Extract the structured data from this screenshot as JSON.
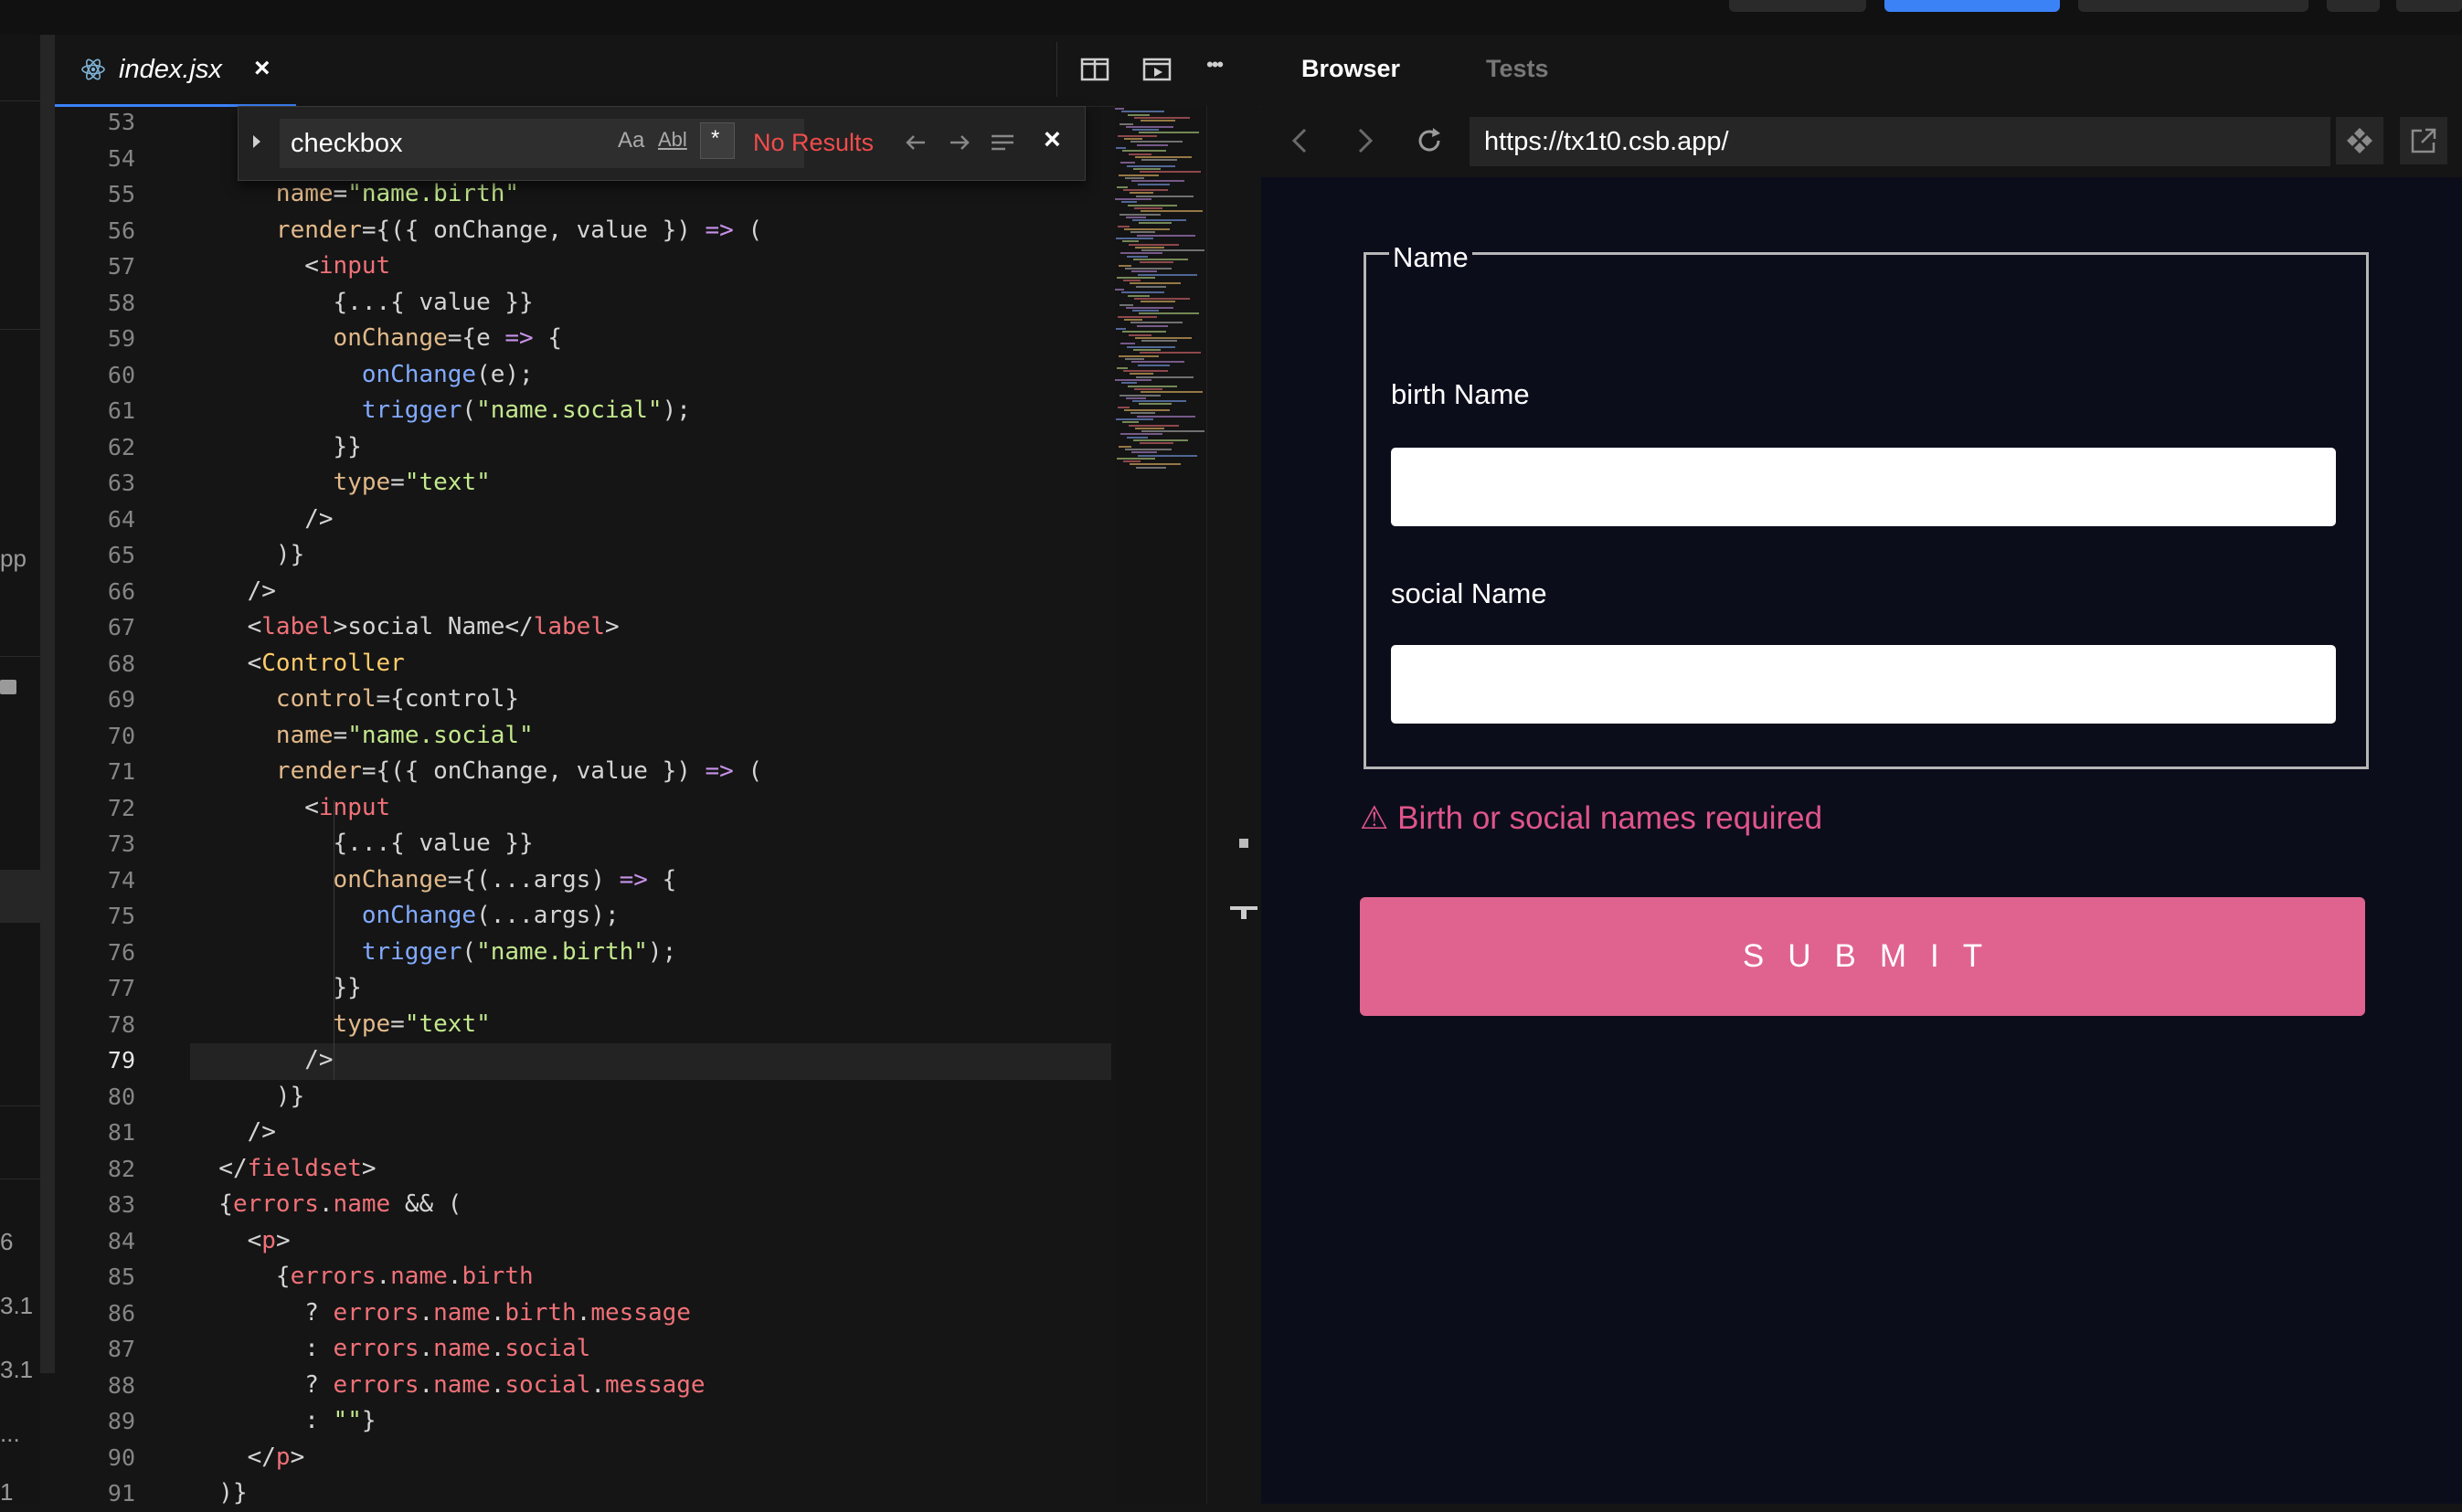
{
  "colors": {
    "accent": "#3b82f6",
    "error": "#e0558a",
    "submit": "#df638e",
    "browser_bg": "#0c0d1b"
  },
  "left_strip": {
    "fragments": [
      "pp",
      "6",
      "3.1",
      "3.1",
      "...",
      "1"
    ]
  },
  "editor": {
    "tab": {
      "title": "index.jsx",
      "close": "×",
      "icon": "react-icon"
    },
    "toolbar": {
      "more": "•••"
    },
    "find": {
      "query": "checkbox",
      "case_label": "Aa",
      "word_label": "Abl",
      "regex_label": "*",
      "status": "No Results",
      "close": "×"
    },
    "current_line": "79",
    "lines": [
      {
        "n": "53",
        "h": ""
      },
      {
        "n": "54",
        "h": ""
      },
      {
        "n": "55",
        "h": "      <span class=\"t-attr\">name</span>=<span class=\"t-str\">\"name.birth\"</span>"
      },
      {
        "n": "56",
        "h": "      <span class=\"t-attr\">render</span>={({ onChange, value }) <span class=\"t-kw\">=&gt;</span> ("
      },
      {
        "n": "57",
        "h": "        &lt;<span class=\"t-tag\">input</span>"
      },
      {
        "n": "58",
        "h": "          {...{ value }}"
      },
      {
        "n": "59",
        "h": "          <span class=\"t-attr\">onChange</span>={e <span class=\"t-kw\">=&gt;</span> {"
      },
      {
        "n": "60",
        "h": "            <span class=\"t-fn\">onChange</span>(e);"
      },
      {
        "n": "61",
        "h": "            <span class=\"t-fn\">trigger</span>(<span class=\"t-str\">\"name.social\"</span>);"
      },
      {
        "n": "62",
        "h": "          }}"
      },
      {
        "n": "63",
        "h": "          <span class=\"t-attr\">type</span>=<span class=\"t-str\">\"text\"</span>"
      },
      {
        "n": "64",
        "h": "        /&gt;"
      },
      {
        "n": "65",
        "h": "      )}"
      },
      {
        "n": "66",
        "h": "    /&gt;"
      },
      {
        "n": "67",
        "h": "    &lt;<span class=\"t-tag\">label</span>&gt;social Name&lt;/<span class=\"t-tag\">label</span>&gt;"
      },
      {
        "n": "68",
        "h": "    &lt;<span class=\"t-comp\">Controller</span>"
      },
      {
        "n": "69",
        "h": "      <span class=\"t-attr\">control</span>={control}"
      },
      {
        "n": "70",
        "h": "      <span class=\"t-attr\">name</span>=<span class=\"t-str\">\"name.social\"</span>"
      },
      {
        "n": "71",
        "h": "      <span class=\"t-attr\">render</span>={({ onChange, value }) <span class=\"t-kw\">=&gt;</span> ("
      },
      {
        "n": "72",
        "h": "        &lt;<span class=\"t-tag\">input</span>"
      },
      {
        "n": "73",
        "h": "          {...{ value }}"
      },
      {
        "n": "74",
        "h": "          <span class=\"t-attr\">onChange</span>={(...args) <span class=\"t-kw\">=&gt;</span> {"
      },
      {
        "n": "75",
        "h": "            <span class=\"t-fn\">onChange</span>(...args);"
      },
      {
        "n": "76",
        "h": "            <span class=\"t-fn\">trigger</span>(<span class=\"t-str\">\"name.birth\"</span>);"
      },
      {
        "n": "77",
        "h": "          }}"
      },
      {
        "n": "78",
        "h": "          <span class=\"t-attr\">type</span>=<span class=\"t-str\">\"text\"</span>"
      },
      {
        "n": "79",
        "h": "        /&gt;"
      },
      {
        "n": "80",
        "h": "      )}"
      },
      {
        "n": "81",
        "h": "    /&gt;"
      },
      {
        "n": "82",
        "h": "  &lt;/<span class=\"t-tag\">fieldset</span>&gt;"
      },
      {
        "n": "83",
        "h": "  {<span class=\"t-err\">errors</span>.<span class=\"t-err\">name</span> &amp;&amp; ("
      },
      {
        "n": "84",
        "h": "    &lt;<span class=\"t-tag\">p</span>&gt;"
      },
      {
        "n": "85",
        "h": "      {<span class=\"t-err\">errors</span>.<span class=\"t-err\">name</span>.<span class=\"t-err\">birth</span>"
      },
      {
        "n": "86",
        "h": "        ? <span class=\"t-err\">errors</span>.<span class=\"t-err\">name</span>.<span class=\"t-err\">birth</span>.<span class=\"t-err\">message</span>"
      },
      {
        "n": "87",
        "h": "        : <span class=\"t-err\">errors</span>.<span class=\"t-err\">name</span>.<span class=\"t-err\">social</span>"
      },
      {
        "n": "88",
        "h": "        ? <span class=\"t-err\">errors</span>.<span class=\"t-err\">name</span>.<span class=\"t-err\">social</span>.<span class=\"t-err\">message</span>"
      },
      {
        "n": "89",
        "h": "        : <span class=\"t-str\">\"\"</span>}"
      },
      {
        "n": "90",
        "h": "    &lt;/<span class=\"t-tag\">p</span>&gt;"
      },
      {
        "n": "91",
        "h": "  )}"
      }
    ]
  },
  "browser": {
    "tabs": [
      "Browser",
      "Tests"
    ],
    "active_tab": "Browser",
    "url": "https://tx1t0.csb.app/",
    "form": {
      "legend": "Name",
      "birth_label": "birth Name",
      "birth_value": "",
      "social_label": "social Name",
      "social_value": "",
      "error_icon": "⚠",
      "error": "Birth or social names required",
      "submit": "SUBMIT"
    }
  }
}
